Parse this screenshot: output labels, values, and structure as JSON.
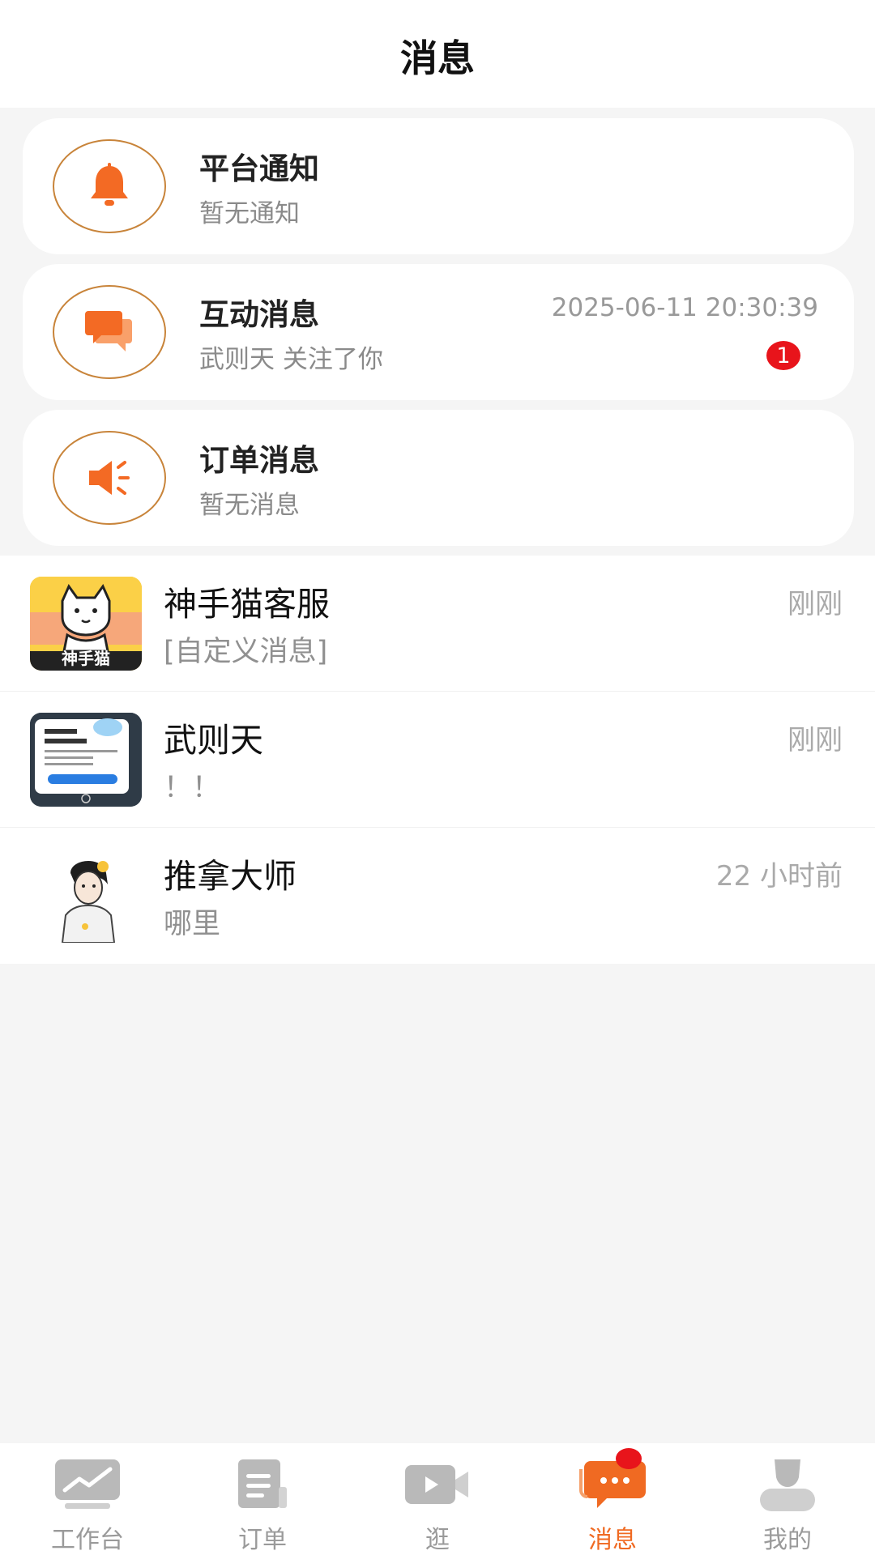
{
  "header": {
    "title": "消息"
  },
  "system_cards": [
    {
      "icon": "bell-icon",
      "title": "平台通知",
      "subtitle": "暂无通知",
      "time": "",
      "badge": ""
    },
    {
      "icon": "chat-bubbles-icon",
      "title": "互动消息",
      "subtitle": "武则天 关注了你",
      "time": "2025-06-11 20:30:39",
      "badge": "1"
    },
    {
      "icon": "speaker-icon",
      "title": "订单消息",
      "subtitle": "暂无消息",
      "time": "",
      "badge": ""
    }
  ],
  "chats": [
    {
      "avatar": "cat-logo-avatar",
      "avatar_text": "神手猫",
      "name": "神手猫客服",
      "preview": "[自定义消息]",
      "time": "刚刚"
    },
    {
      "avatar": "screenshot-avatar",
      "avatar_text": "",
      "name": "武则天",
      "preview": "！！",
      "time": "刚刚"
    },
    {
      "avatar": "anime-man-avatar",
      "avatar_text": "",
      "name": "推拿大师",
      "preview": "哪里",
      "time": "22 小时前"
    }
  ],
  "tabbar": [
    {
      "icon": "chart-icon",
      "label": "工作台",
      "active": false
    },
    {
      "icon": "order-doc-icon",
      "label": "订单",
      "active": false
    },
    {
      "icon": "video-icon",
      "label": "逛",
      "active": false
    },
    {
      "icon": "message-icon",
      "label": "消息",
      "active": true,
      "has_dot": true
    },
    {
      "icon": "user-icon",
      "label": "我的",
      "active": false
    }
  ],
  "colors": {
    "accent": "#f06a22",
    "ring": "#c8843a",
    "badge": "#e8141b",
    "background": "#f5f5f5"
  }
}
